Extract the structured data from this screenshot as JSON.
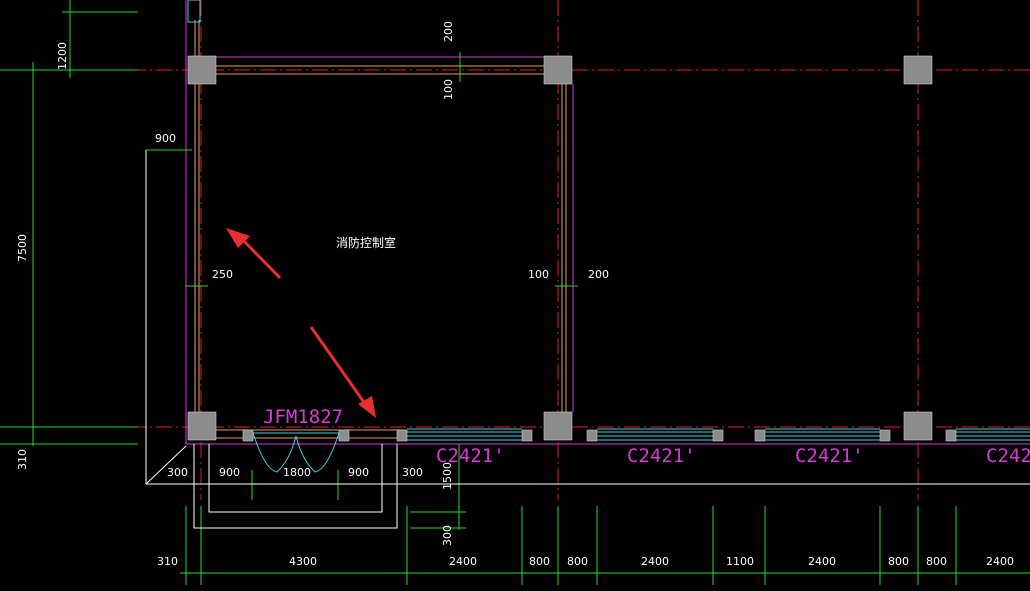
{
  "drawing": {
    "room_label": "消防控制室",
    "door_tag": "JFM1827",
    "window_tag": "C2421'",
    "window_tag_cut": "C242",
    "dims": {
      "d1200": "1200",
      "d7500": "7500",
      "d310_left": "310",
      "d200_top": "200",
      "d100_top": "100",
      "d900_left": "900",
      "d250": "250",
      "d100_right": "100",
      "d200_right": "200",
      "door": [
        "300",
        "900",
        "1800",
        "900",
        "300"
      ],
      "d1500": "1500",
      "d300": "300",
      "bottom": [
        "310",
        "4300",
        "2400",
        "800",
        "800",
        "2400",
        "1100",
        "2400",
        "800",
        "800",
        "2400"
      ]
    }
  },
  "colors": {
    "background": "#000000",
    "axis_red": "#e02020",
    "dim_green": "#22dd22",
    "wall_orange": "#e0a060",
    "wall_magenta": "#d63bd6",
    "window_cyan": "#3fd0e0",
    "column_gray": "#8c8c8c",
    "arrow_red": "#e83030",
    "outline_white": "#ffffff"
  }
}
